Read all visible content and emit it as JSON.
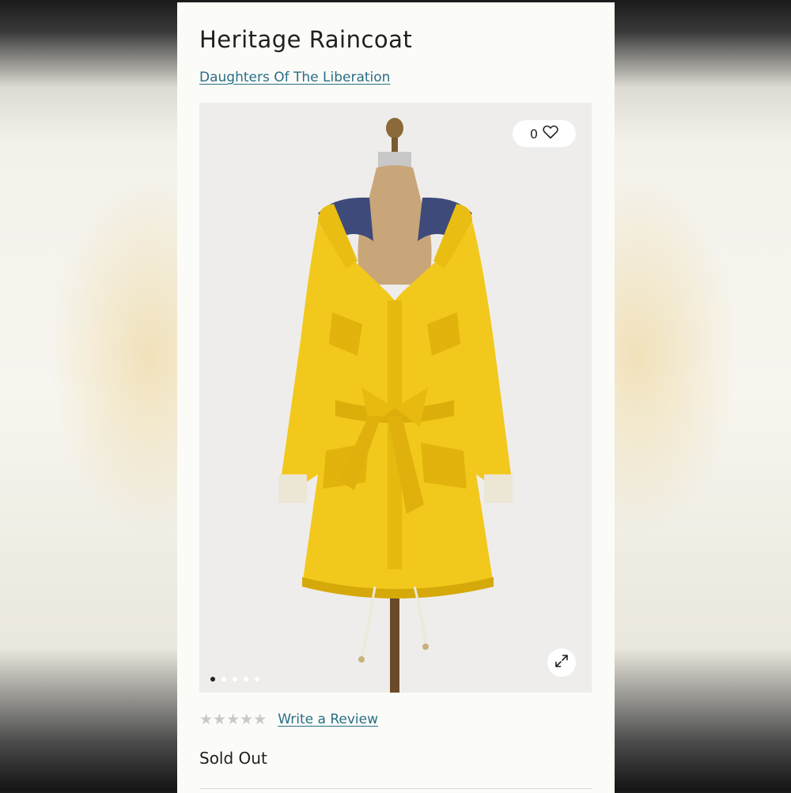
{
  "product": {
    "title": "Heritage Raincoat",
    "brand": "Daughters Of The Liberation",
    "favorites_count": "0",
    "rating": {
      "value": 0,
      "max": 5
    },
    "write_review_label": "Write a Review",
    "stock_status": "Sold Out"
  },
  "gallery": {
    "image_description": "yellow-hooded-raincoat-on-dress-form",
    "slide_count": 5,
    "active_slide": 1
  },
  "icons": {
    "favorite": "heart-icon",
    "expand": "expand-icon",
    "star": "star-icon"
  },
  "colors": {
    "link": "#2a6e86",
    "coat": "#f2c81c",
    "star_empty": "#c9c9c9",
    "card_bg": "#fbfbf8"
  }
}
